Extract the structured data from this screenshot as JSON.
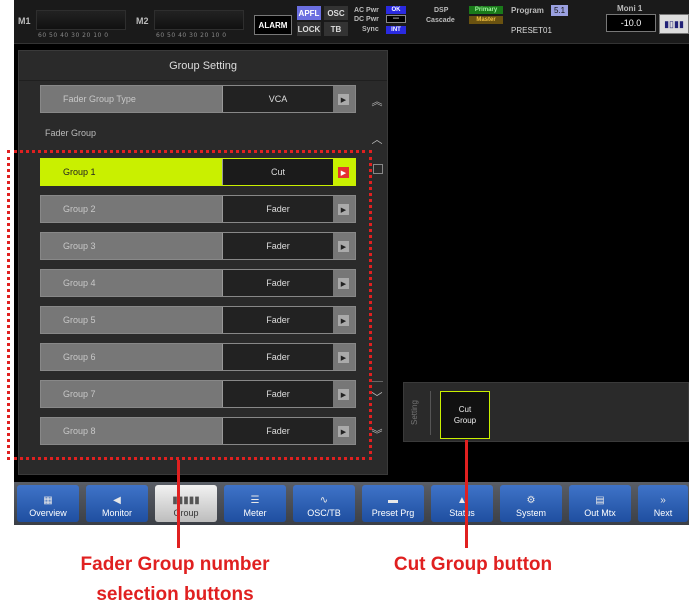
{
  "topbar": {
    "m1_label": "M1",
    "m2_label": "M2",
    "meter_scale": "60 50 40 30 20 10 0",
    "alarm": "ALARM",
    "apfl": "APFL",
    "lock": "LOCK",
    "osc": "OSC",
    "tb": "TB",
    "ac_pwr": "AC Pwr",
    "ac_pwr_state": "OK",
    "dc_pwr": "DC Pwr",
    "dc_pwr_state": "---",
    "sync": "Sync",
    "sync_state": "INT",
    "dsp": "DSP",
    "dsp_state": "Primary",
    "cascade": "Cascade",
    "cascade_state": "Master",
    "program_label": "Program",
    "program_value": "5.1",
    "program_name": "PRESET01",
    "moni_label": "Moni 1",
    "moni_value": "-10.0"
  },
  "panel": {
    "title": "Group Setting",
    "type_label": "Fader Group Type",
    "type_value": "VCA",
    "section_label": "Fader Group",
    "groups": [
      {
        "label": "Group 1",
        "value": "Cut"
      },
      {
        "label": "Group 2",
        "value": "Fader"
      },
      {
        "label": "Group 3",
        "value": "Fader"
      },
      {
        "label": "Group 4",
        "value": "Fader"
      },
      {
        "label": "Group 5",
        "value": "Fader"
      },
      {
        "label": "Group 6",
        "value": "Fader"
      },
      {
        "label": "Group 7",
        "value": "Fader"
      },
      {
        "label": "Group 8",
        "value": "Fader"
      }
    ],
    "selected_group": 1
  },
  "setting": {
    "label": "Setting",
    "cut_group_line1": "Cut",
    "cut_group_line2": "Group"
  },
  "tabs": [
    {
      "label": "Overview",
      "icon": "grid-icon"
    },
    {
      "label": "Monitor",
      "icon": "speaker-icon"
    },
    {
      "label": "Group",
      "icon": "fader-group-icon"
    },
    {
      "label": "Meter",
      "icon": "meter-icon"
    },
    {
      "label": "OSC/TB",
      "icon": "osc-icon"
    },
    {
      "label": "Preset Prg",
      "icon": "preset-icon"
    },
    {
      "label": "Status",
      "icon": "warning-icon"
    },
    {
      "label": "System",
      "icon": "gear-icon"
    },
    {
      "label": "Out Mtx",
      "icon": "matrix-icon"
    },
    {
      "label": "Next",
      "icon": "chevron-right-icon"
    }
  ],
  "active_tab": "Group",
  "annotations": {
    "fader_group": [
      "Fader Group number",
      "selection buttons"
    ],
    "cut_group": "Cut Group button"
  },
  "colors": {
    "selected": "#c9f000",
    "annotation": "#e02020",
    "tab_blue": "#2f5fb0",
    "apfl": "#6a6ee0"
  }
}
